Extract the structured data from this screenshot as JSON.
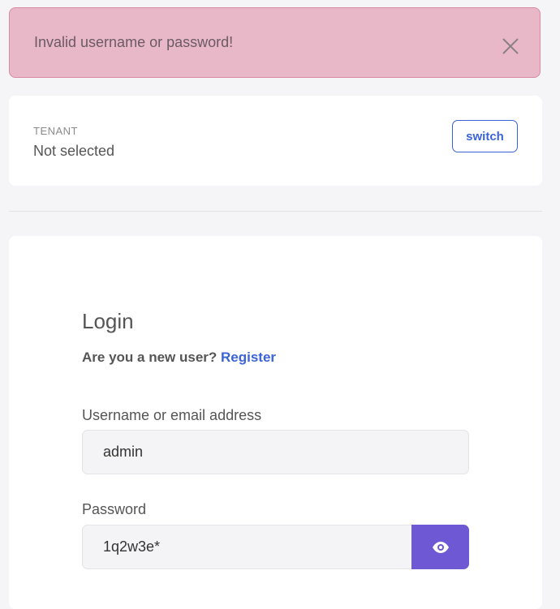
{
  "alert": {
    "message": "Invalid username or password!",
    "close_icon": "close-icon"
  },
  "tenant": {
    "label": "TENANT",
    "value": "Not selected",
    "switch_label": "switch"
  },
  "login": {
    "title": "Login",
    "new_user_prompt": "Are you a new user?",
    "register_label": "Register",
    "username_label": "Username or email address",
    "username_value": "admin",
    "password_label": "Password",
    "password_value": "1q2w3e*",
    "toggle_icon": "eye-icon"
  },
  "colors": {
    "alert_bg": "#e8b8c8",
    "accent_blue": "#3a63d8",
    "toggle_purple": "#6e58d4"
  }
}
